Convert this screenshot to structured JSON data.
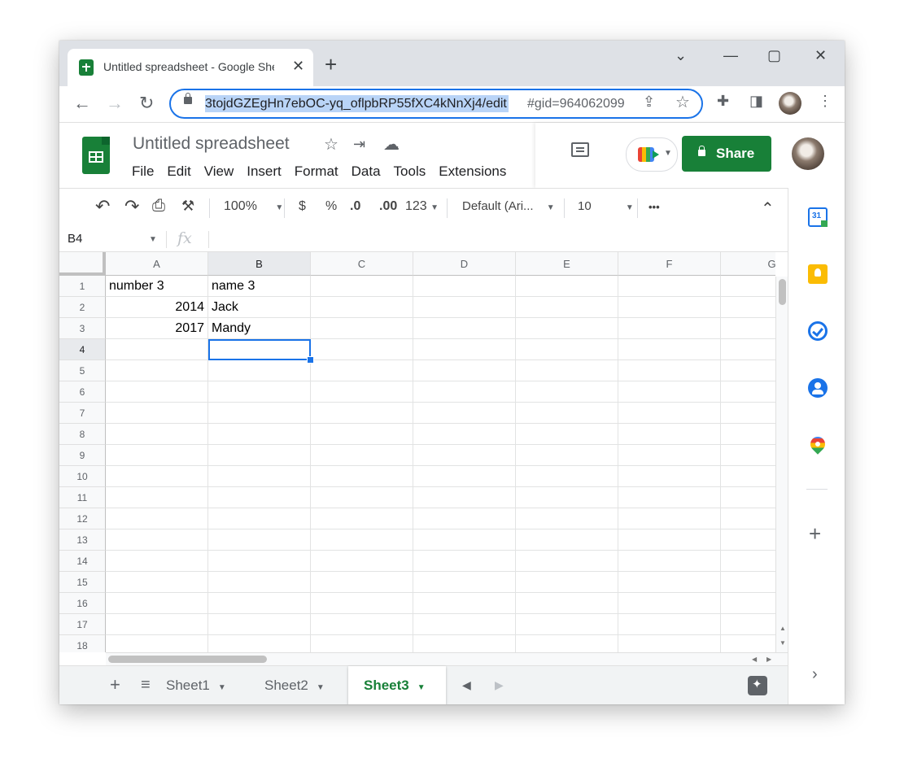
{
  "browser": {
    "tab_title": "Untitled spreadsheet - Google Sheets",
    "new_tab": "+",
    "url_selected": "3tojdGZEgHn7ebOC-yq_oflpbRP55fXC4kNnXj4/edit",
    "url_rest": "#gid=964062099"
  },
  "icons": {
    "close": "✕",
    "minimize": "⌄",
    "maximize": "▢",
    "window_close": "✕",
    "back": "←",
    "forward": "→",
    "reload": "↻",
    "share_page": "⇪",
    "bookmark": "☆",
    "extensions": "✚",
    "sidepanel": "◨",
    "kebab": "⋮",
    "star": "☆",
    "move": "⇥",
    "cloud": "☁",
    "undo": "↶",
    "redo": "↷",
    "print": "⎙",
    "paint": "⚒",
    "more": "•••",
    "collapse": "⌃",
    "add_sheet": "+",
    "all_sheets": "≡",
    "prev_sheet": "◀",
    "next_sheet": "▶"
  },
  "doc": {
    "title": "Untitled spreadsheet",
    "menu": [
      "File",
      "Edit",
      "View",
      "Insert",
      "Format",
      "Data",
      "Tools",
      "Extensions"
    ],
    "share_label": "Share"
  },
  "toolbar": {
    "zoom": "100%",
    "currency": "$",
    "percent": "%",
    "dec_decrease": ".0",
    "dec_increase": ".00",
    "number_format": "123",
    "font": "Default (Ari...",
    "font_size": "10"
  },
  "formula_bar": {
    "name_box": "B4",
    "fx": "fx"
  },
  "grid": {
    "columns": [
      "A",
      "B",
      "C",
      "D",
      "E",
      "F",
      "G"
    ],
    "rows": [
      "1",
      "2",
      "3",
      "4",
      "5",
      "6",
      "7",
      "8",
      "9",
      "10",
      "11",
      "12",
      "13",
      "14",
      "15",
      "16",
      "17",
      "18"
    ],
    "cells": [
      [
        "number 3",
        "name 3"
      ],
      [
        "2014",
        "Jack"
      ],
      [
        "2017",
        "Mandy"
      ]
    ],
    "active_cell": "B4"
  },
  "sheets": {
    "tabs": [
      "Sheet1",
      "Sheet2",
      "Sheet3"
    ],
    "active": "Sheet3"
  },
  "colors": {
    "accent": "#1a73e8",
    "sheets_green": "#188038",
    "underline_red": "#d93025"
  }
}
